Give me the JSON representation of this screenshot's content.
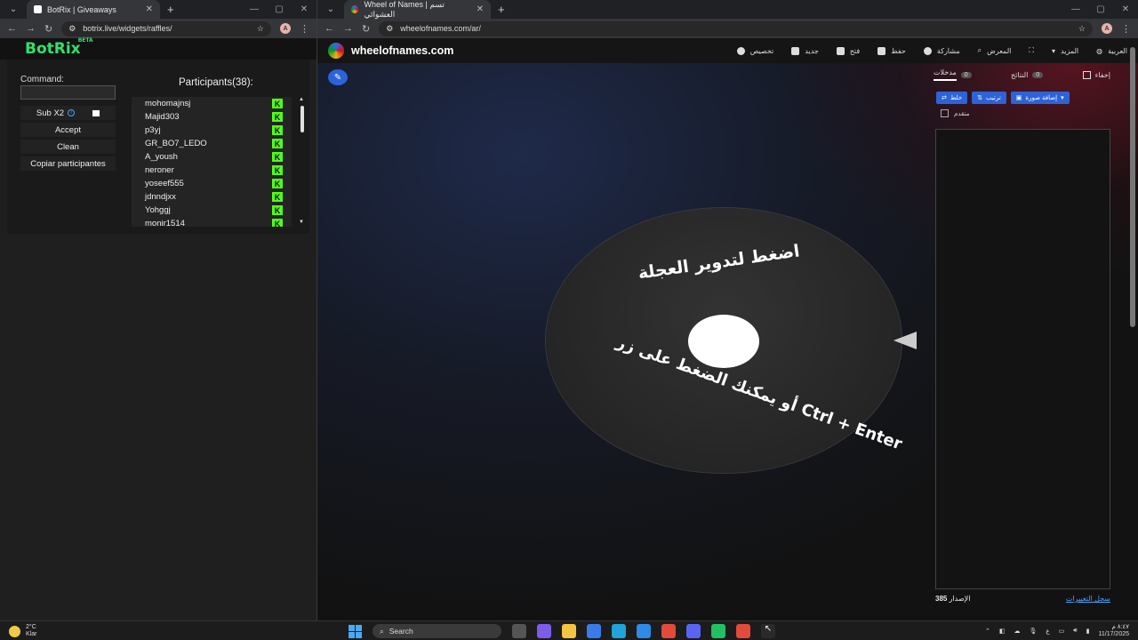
{
  "left_window": {
    "tab_title": "BotRix | Giveaways",
    "url": "botrix.live/widgets/raffles/",
    "avatar": "A",
    "logo": "BotRix",
    "logo_badge": "BETA",
    "command_label": "Command:",
    "command_value": "",
    "options": [
      {
        "label": "Sub X2"
      },
      {
        "label": "Accept"
      },
      {
        "label": "Clean"
      },
      {
        "label": "Copiar participantes"
      }
    ],
    "participants_title": "Participants(38):",
    "participants": [
      "mohomajnsj",
      "Majid303",
      "p3yj",
      "GR_BO7_LEDO",
      "A_yoush",
      "neroner",
      "yoseef555",
      "jdnndjxx",
      "Yohggj",
      "monir1514"
    ],
    "platform_badge": "K"
  },
  "right_window": {
    "tab_title": "Wheel of Names | تسم العشوائي",
    "url": "wheelofnames.com/ar/",
    "avatar": "A",
    "site_name": "wheelofnames.com",
    "menu": [
      "تخصيص",
      "جديد",
      "فتح",
      "حفظ",
      "مشاركة",
      "المعرض",
      "المزيد",
      "العربية"
    ],
    "wheel_top_text": "اضغط لتدوير العجلة",
    "wheel_bottom_text": "أو يمكنك الضغط على زر Ctrl + Enter",
    "sidebar": {
      "hide_label": "إخفاء",
      "tab_results": "النتائج",
      "tab_results_count": "0",
      "tab_entries": "مدخلات",
      "tab_entries_count": "0",
      "btn_shuffle": "خلط",
      "btn_sort": "ترتيب",
      "btn_add_image": "إضافة صورة",
      "advanced_label": "متقدم",
      "version_label": "الإصدار",
      "version_number": "385",
      "changelog": "سجل التغييرات"
    },
    "accent_color": "#2d63d9"
  },
  "taskbar": {
    "weather_temp": "2°C",
    "weather_desc": "Klar",
    "search_placeholder": "Search",
    "time": "٨:٤٧ م",
    "date": "11/17/2025",
    "lang": "ع"
  }
}
